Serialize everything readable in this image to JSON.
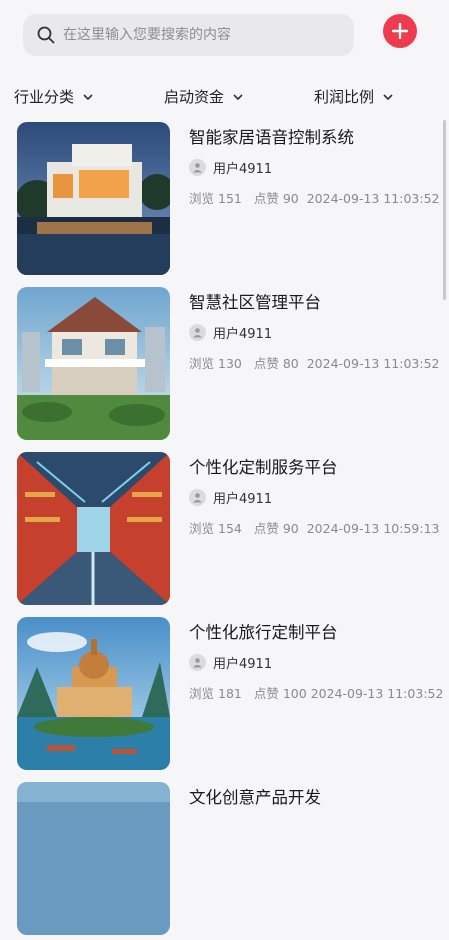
{
  "search": {
    "placeholder": "在这里输入您要搜索的内容",
    "value": ""
  },
  "header": {
    "add_button_icon": "plus-icon"
  },
  "filters": [
    {
      "label": "行业分类"
    },
    {
      "label": "启动资金"
    },
    {
      "label": "利润比例"
    }
  ],
  "items": [
    {
      "title": "智能家居语音控制系统",
      "user": "用户4911",
      "views_label": "浏览",
      "views": "151",
      "likes_label": "点赞",
      "likes": "90",
      "time": "2024-09-13 11:03:52"
    },
    {
      "title": "智慧社区管理平台",
      "user": "用户4911",
      "views_label": "浏览",
      "views": "130",
      "likes_label": "点赞",
      "likes": "80",
      "time": "2024-09-13 11:03:52"
    },
    {
      "title": "个性化定制服务平台",
      "user": "用户4911",
      "views_label": "浏览",
      "views": "154",
      "likes_label": "点赞",
      "likes": "90",
      "time": "2024-09-13 10:59:13"
    },
    {
      "title": "个性化旅行定制平台",
      "user": "用户4911",
      "views_label": "浏览",
      "views": "181",
      "likes_label": "点赞",
      "likes": "100",
      "time": "2024-09-13 11:03:52"
    },
    {
      "title": "文化创意产品开发",
      "user": "",
      "views_label": "",
      "views": "",
      "likes_label": "",
      "likes": "",
      "time": ""
    }
  ],
  "colors": {
    "accent": "#ee3b4d",
    "background": "#f6f5f7",
    "search_bg": "#e9e8ea"
  }
}
